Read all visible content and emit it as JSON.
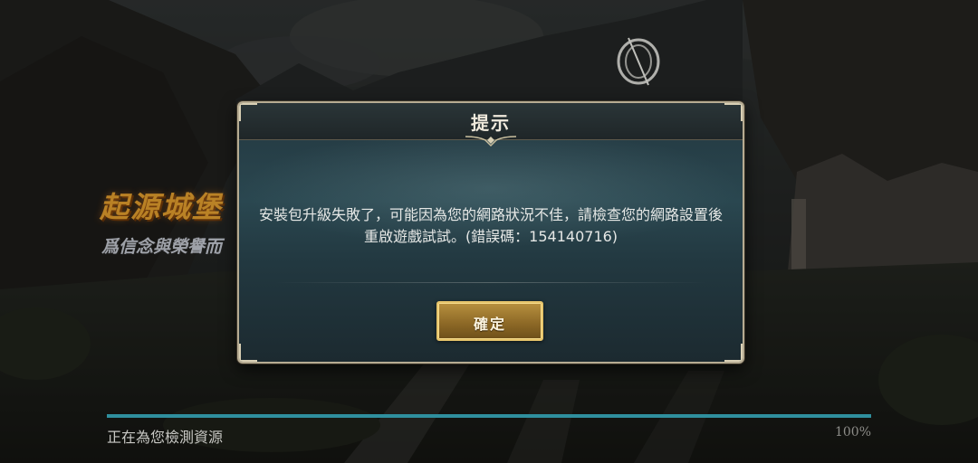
{
  "background": {
    "title": "起源城堡",
    "subtitle": "爲信念與榮譽而"
  },
  "dialog": {
    "title": "提示",
    "message": "安裝包升級失敗了，可能因為您的網路狀況不佳，請檢查您的網路設置後重啟遊戲試試。(錯誤碼：154140716)",
    "confirm_label": "確定"
  },
  "loading": {
    "status": "正在為您檢測資源",
    "percent_label": "100%",
    "progress_fraction": 1.0
  },
  "colors": {
    "accent_gold": "#e6c46a",
    "progress": "#2f8f9e",
    "dialog_border": "#b6ab92"
  },
  "icons": {
    "logo": "ring-logo-icon",
    "ornament": "header-ornament-icon"
  }
}
